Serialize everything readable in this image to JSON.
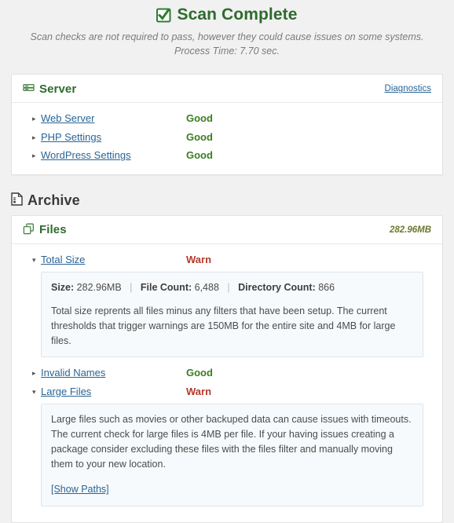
{
  "header": {
    "icon": "checked-checkbox-icon",
    "title": "Scan Complete",
    "note_line1": "Scan checks are not required to pass, however they could cause issues on some systems.",
    "note_line2": "Process Time: 7.70 sec."
  },
  "colors": {
    "green": "#2e6b2e",
    "good": "#3a7d22",
    "warn": "#b33a2b",
    "link": "#2a6496",
    "page_bg": "#f1f1f1"
  },
  "server_panel": {
    "icon": "server-icon",
    "title": "Server",
    "diagnostics_label": "Diagnostics",
    "rows": [
      {
        "marker": "▸",
        "expanded": false,
        "label": "Web Server",
        "status": "Good",
        "state": "good"
      },
      {
        "marker": "▸",
        "expanded": false,
        "label": "PHP Settings",
        "status": "Good",
        "state": "good"
      },
      {
        "marker": "▸",
        "expanded": false,
        "label": "WordPress Settings",
        "status": "Good",
        "state": "good"
      }
    ]
  },
  "archive_section": {
    "icon": "archive-document-icon",
    "title": "Archive"
  },
  "files_panel": {
    "icon": "copy-files-icon",
    "title": "Files",
    "size_label": "282.96MB",
    "rows": [
      {
        "marker": "▾",
        "expanded": true,
        "label": "Total Size",
        "status": "Warn",
        "state": "warn",
        "detail": {
          "stats": [
            {
              "key": "Size:",
              "value": "282.96MB"
            },
            {
              "key": "File Count:",
              "value": "6,488"
            },
            {
              "key": "Directory Count:",
              "value": "866"
            }
          ],
          "separator": "|",
          "text": "Total size reprents all files minus any filters that have been setup. The current thresholds that trigger warnings are 150MB for the entire site and 4MB for large files.",
          "link": null
        }
      },
      {
        "marker": "▸",
        "expanded": false,
        "label": "Invalid Names",
        "status": "Good",
        "state": "good",
        "detail": null
      },
      {
        "marker": "▾",
        "expanded": true,
        "label": "Large Files",
        "status": "Warn",
        "state": "warn",
        "detail": {
          "stats": [],
          "separator": "|",
          "text": "Large files such as movies or other backuped data can cause issues with timeouts. The current check for large files is 4MB per file. If your having issues creating a package consider excluding these files with the files filter and manually moving them to your new location.",
          "link": "[Show Paths]"
        }
      }
    ]
  }
}
